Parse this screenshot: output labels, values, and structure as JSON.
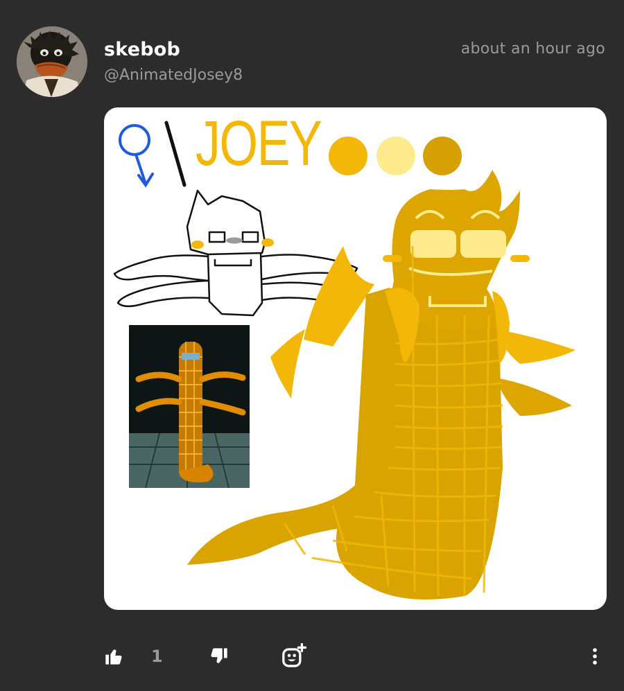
{
  "author": {
    "display_name": "skebob",
    "handle": "@AnimatedJosey8"
  },
  "timestamp": "about an hour ago",
  "post_image": {
    "title_text": "JOEY",
    "palette": [
      "#f2b707",
      "#fdeb8e",
      "#d5a004"
    ]
  },
  "actions": {
    "like_icon": "thumbs-up-icon",
    "like_count": "1",
    "dislike_icon": "thumbs-down-icon",
    "react_icon": "add-reaction-icon",
    "more_icon": "more-vertical-icon"
  },
  "colors": {
    "background": "#2b2c2b",
    "name": "#ffffff",
    "secondary_text": "#9a9a98",
    "icon": "#ffffff"
  }
}
